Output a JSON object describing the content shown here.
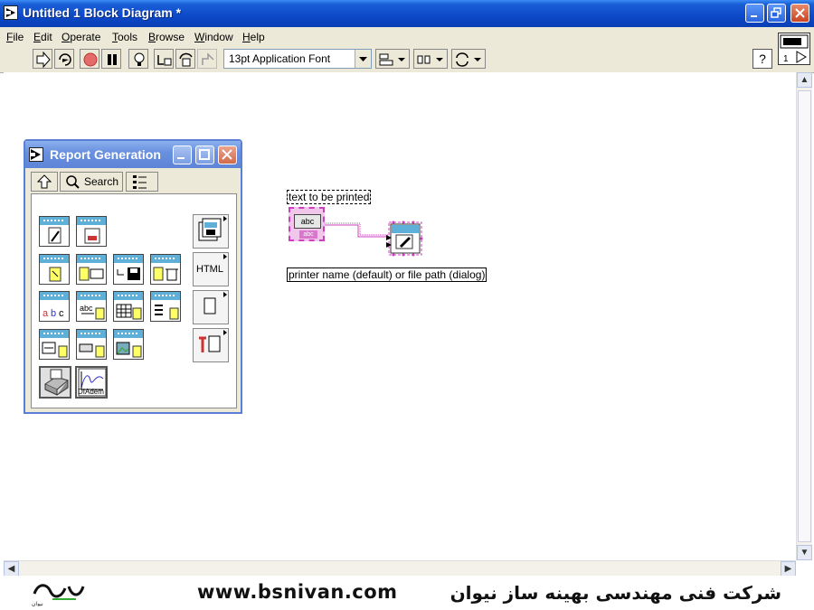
{
  "window": {
    "title": "Untitled 1 Block Diagram *"
  },
  "menu": [
    "File",
    "Edit",
    "Operate",
    "Tools",
    "Browse",
    "Window",
    "Help"
  ],
  "toolbar": {
    "font_select": "13pt Application Font",
    "help_label": "?"
  },
  "connector_pane": {
    "label": "1"
  },
  "palette": {
    "title": "Report Generation",
    "search_label": "Search",
    "html_label": "HTML",
    "diadem_label": "DIAdem"
  },
  "diagram": {
    "control_label": "text to be printed",
    "control_inner": "abc",
    "control_type": "abc",
    "constant_label": "printer name (default) or file path (dialog)"
  },
  "footer": {
    "url": "www.bsnivan.com",
    "company": "شرکت فنی مهندسی بهینه ساز نیوان"
  },
  "colors": {
    "titlebar": "#0c48c8",
    "wire": "#cc3fbf",
    "vi_header": "#5fb0d8"
  }
}
